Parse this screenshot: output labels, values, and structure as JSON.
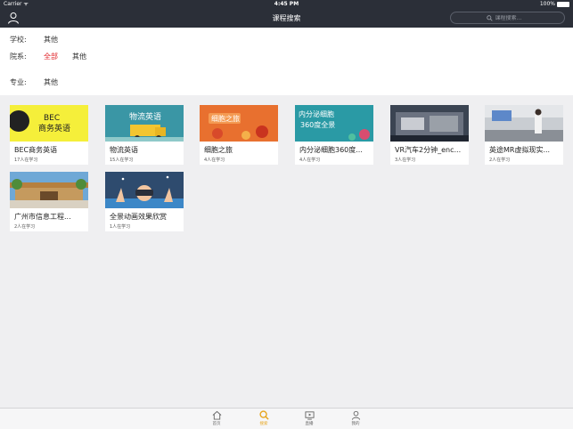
{
  "status_bar": {
    "carrier": "Carrier ᯤ",
    "time": "4:45 PM",
    "battery": "100%"
  },
  "navbar": {
    "title": "课程搜索",
    "search_placeholder": "课程搜索..."
  },
  "filters": {
    "school": {
      "label": "学校:",
      "options": [
        "其他"
      ]
    },
    "department": {
      "label": "院系:",
      "options": [
        "全部",
        "其他"
      ],
      "selected": "全部"
    },
    "major": {
      "label": "专业:",
      "options": [
        "其他"
      ]
    }
  },
  "courses": [
    {
      "title": "BEC商务英语",
      "learners": "17人在学习",
      "thumb_text": "BEC 商务英语",
      "thumb_color": "#f5ef3a"
    },
    {
      "title": "物流英语",
      "learners": "15人在学习",
      "thumb_text": "物流英语",
      "thumb_color": "#3a96a5"
    },
    {
      "title": "细胞之旅",
      "learners": "4人在学习",
      "thumb_text": "细胞之旅",
      "thumb_color": "#e8702f"
    },
    {
      "title": "内分泌细胞360度...",
      "learners": "4人在学习",
      "thumb_text": "内分泌细胞 360度全景",
      "thumb_color": "#2a9aa5"
    },
    {
      "title": "VR汽车2分钟_enc...",
      "learners": "3人在学习",
      "thumb_text": "",
      "thumb_color": "#3b4452"
    },
    {
      "title": "英途MR虚拟现实...",
      "learners": "2人在学习",
      "thumb_text": "",
      "thumb_color": "#8a8f96"
    },
    {
      "title": "广州市信息工程...",
      "learners": "2人在学习",
      "thumb_text": "",
      "thumb_color": "#6fa8d6"
    },
    {
      "title": "全景动画效果欣赏",
      "learners": "1人在学习",
      "thumb_text": "",
      "thumb_color": "#2e4b6e"
    }
  ],
  "tabbar": {
    "items": [
      {
        "label": "首页",
        "icon": "home-icon",
        "active": false
      },
      {
        "label": "搜索",
        "icon": "search-icon",
        "active": true
      },
      {
        "label": "直播",
        "icon": "live-icon",
        "active": false
      },
      {
        "label": "我的",
        "icon": "profile-icon",
        "active": false
      }
    ]
  },
  "colors": {
    "nav_bg": "#2b2f38",
    "accent_red": "#e0242a",
    "active_tab": "#e7a51d"
  }
}
